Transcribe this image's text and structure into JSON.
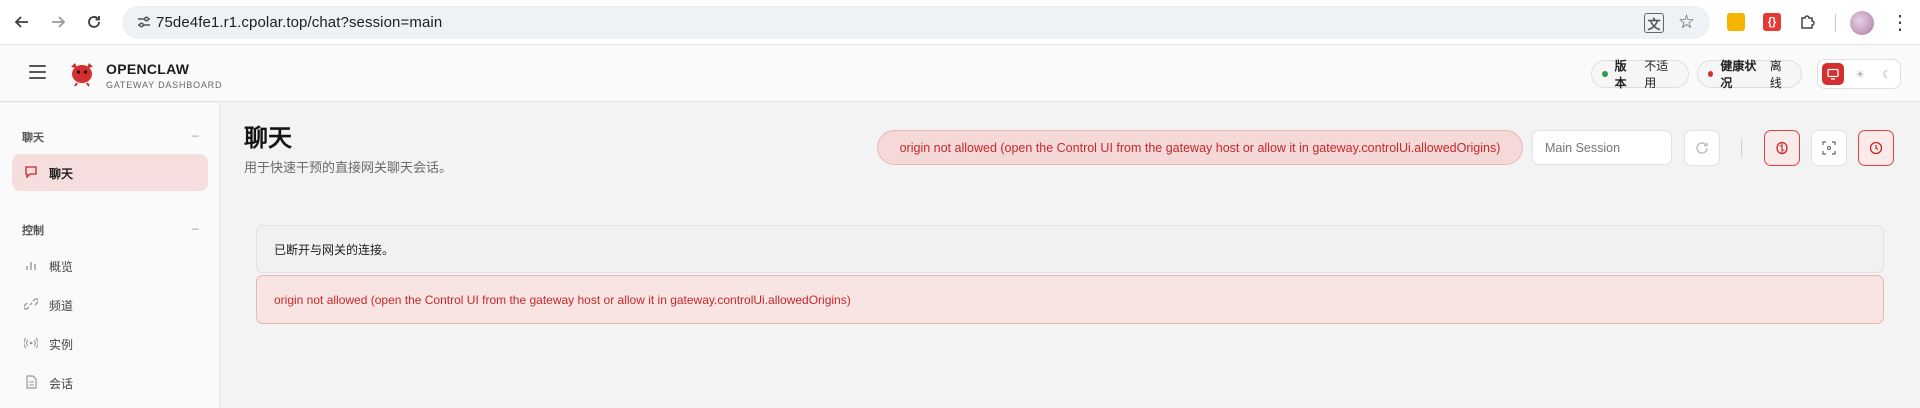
{
  "browser": {
    "url": "75de4fe1.r1.cpolar.top/chat?session=main",
    "icons": [
      "back-arrow-icon",
      "forward-arrow-icon",
      "reload-icon",
      "site-settings-icon",
      "translate-icon",
      "bookmark-star-icon",
      "extension-icon",
      "puzzle-icon",
      "profile-avatar",
      "more-menu-icon"
    ]
  },
  "header": {
    "brand_title": "OPENCLAW",
    "brand_subtitle": "GATEWAY DASHBOARD",
    "version_label": "版本",
    "version_value": "不适用",
    "health_label": "健康状况",
    "health_value": "离线",
    "version_dot_color": "#2e9e44",
    "health_dot_color": "#d32f2f",
    "accent_color": "#d32f2f"
  },
  "sidebar": {
    "sections": [
      {
        "title": "聊天",
        "collapse": "–",
        "items": [
          {
            "label": "聊天",
            "icon": "chat-bubble-icon",
            "active": true
          }
        ]
      },
      {
        "title": "控制",
        "collapse": "–",
        "items": [
          {
            "label": "概览",
            "icon": "bar-chart-icon",
            "active": false
          },
          {
            "label": "频道",
            "icon": "link-icon",
            "active": false
          },
          {
            "label": "实例",
            "icon": "broadcast-icon",
            "active": false
          },
          {
            "label": "会话",
            "icon": "document-icon",
            "active": false
          }
        ]
      }
    ]
  },
  "main": {
    "title": "聊天",
    "subtitle": "用于快速干预的直接网关聊天会话。",
    "error_pill": "origin not allowed (open the Control UI from the gateway host or allow it in gateway.controlUi.allowedOrigins)",
    "session_placeholder": "Main Session",
    "disconnected_notice": "已断开与网关的连接。",
    "error_message": "origin not allowed (open the Control UI from the gateway host or allow it in gateway.controlUi.allowedOrigins)"
  }
}
